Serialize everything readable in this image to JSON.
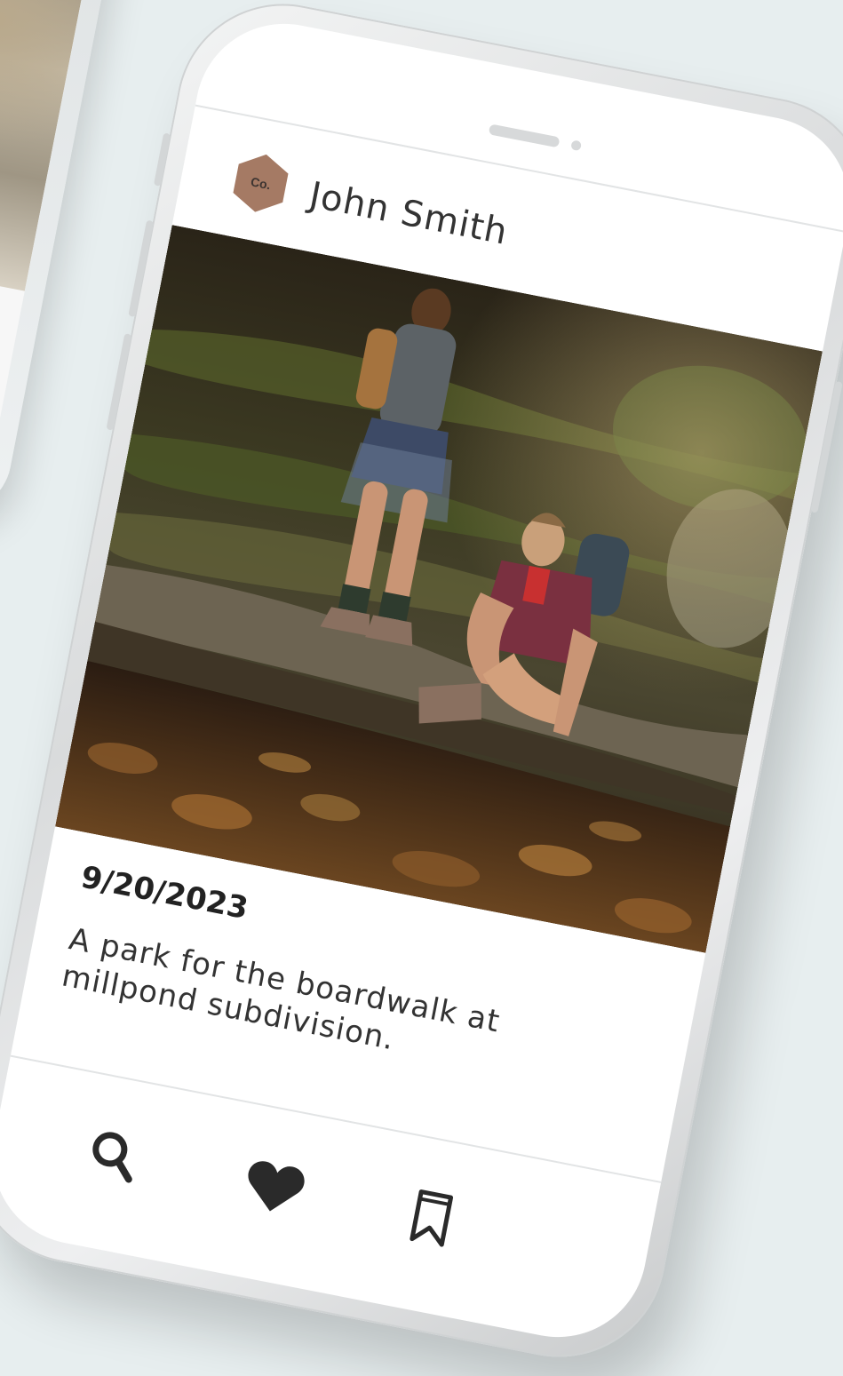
{
  "profile": {
    "logo_text": "Co.",
    "name": "John Smith"
  },
  "post": {
    "date": "9/20/2023",
    "caption": "A park for the boardwalk at millpond subdivision."
  },
  "actions": {
    "share_icon": "share-icon",
    "send_icon": "send-icon"
  },
  "nav": {
    "items": [
      {
        "icon": "search-icon"
      },
      {
        "icon": "heart-icon"
      },
      {
        "icon": "bookmark-icon"
      }
    ]
  },
  "colors": {
    "logo": "#a57a64",
    "text": "#333333",
    "background": "#e7eeef"
  }
}
